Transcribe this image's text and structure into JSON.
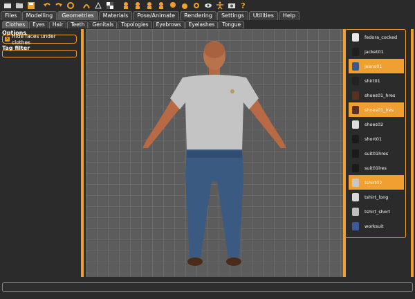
{
  "toolbar": {
    "icons": [
      "file-icon",
      "folder-icon",
      "save-icon",
      "undo-icon",
      "redo-icon",
      "reset-icon",
      "smooth-icon",
      "wireframe-icon",
      "checker-icon",
      "front-view-icon",
      "back-view-icon",
      "left-view-icon",
      "right-view-icon",
      "top-view-icon",
      "bottom-view-icon",
      "reset-camera-icon",
      "eye-icon",
      "pose-icon",
      "camera-icon",
      "help-icon"
    ]
  },
  "main_tabs": [
    "Files",
    "Modelling",
    "Geometries",
    "Materials",
    "Pose/Animate",
    "Rendering",
    "Settings",
    "Utilities",
    "Help"
  ],
  "main_active": "Geometries",
  "sub_tabs": [
    "Clothes",
    "Eyes",
    "Hair",
    "Teeth",
    "Genitals",
    "Topologies",
    "Eyebrows",
    "Eyelashes",
    "Tongue"
  ],
  "sub_active": "Clothes",
  "options": {
    "title": "Options",
    "hide_faces_label": "Hide faces under clothes",
    "hide_faces_checked": true,
    "tag_filter_title": "Tag filter"
  },
  "clothes": [
    {
      "name": "fedora_cocked",
      "selected": false,
      "icon": "hat-icon",
      "color": "#e8e8e8"
    },
    {
      "name": "jacket01",
      "selected": false,
      "icon": "jacket-icon",
      "color": "#202020"
    },
    {
      "name": "jeans01",
      "selected": true,
      "icon": "jeans-icon",
      "color": "#3a5a8a"
    },
    {
      "name": "shirt01",
      "selected": false,
      "icon": "shirt-icon",
      "color": "#222222"
    },
    {
      "name": "shoes01_hres",
      "selected": false,
      "icon": "shoe-icon",
      "color": "#5a3020"
    },
    {
      "name": "shoes01_lres",
      "selected": true,
      "icon": "shoe-icon",
      "color": "#5a3020"
    },
    {
      "name": "shoes02",
      "selected": false,
      "icon": "shoe-icon",
      "color": "#dddddd"
    },
    {
      "name": "short01",
      "selected": false,
      "icon": "shorts-icon",
      "color": "#1a1a1a"
    },
    {
      "name": "suit01hres",
      "selected": false,
      "icon": "suit-icon",
      "color": "#1a1a1a"
    },
    {
      "name": "suit01lres",
      "selected": false,
      "icon": "suit-icon",
      "color": "#1a1a1a"
    },
    {
      "name": "tshirt02",
      "selected": true,
      "icon": "tshirt-icon",
      "color": "#c8c8c8"
    },
    {
      "name": "tshirt_long",
      "selected": false,
      "icon": "tshirt-icon",
      "color": "#d8d8d8"
    },
    {
      "name": "tshirt_short",
      "selected": false,
      "icon": "tshirt-icon",
      "color": "#c0c0c0"
    },
    {
      "name": "worksuit",
      "selected": false,
      "icon": "worksuit-icon",
      "color": "#3a5a9a"
    }
  ],
  "colors": {
    "accent": "#f0a030",
    "viewport": "#5c5c5c",
    "grid": "#6a6a6a"
  }
}
